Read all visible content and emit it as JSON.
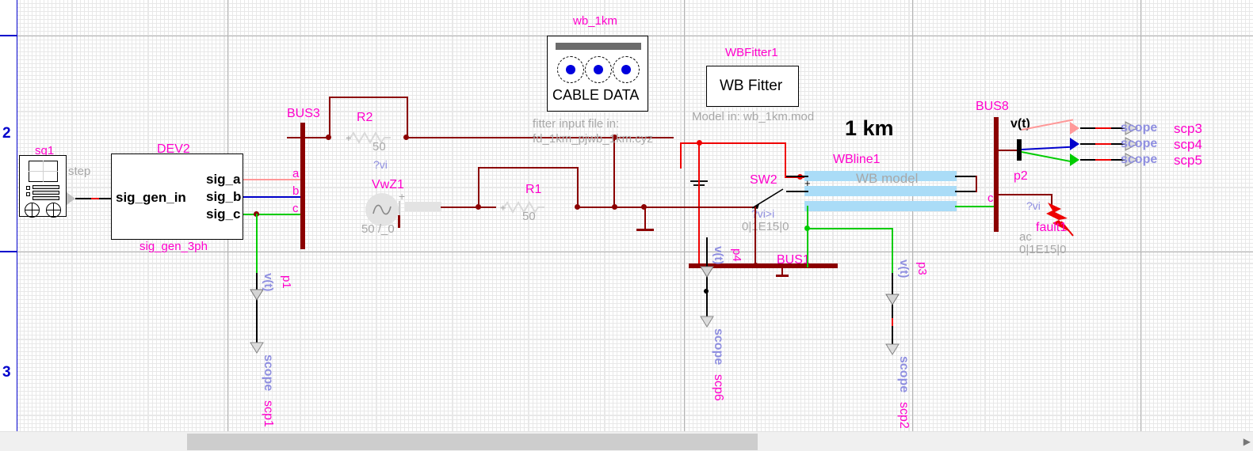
{
  "gutter": {
    "rows": [
      "2",
      "3"
    ]
  },
  "components": {
    "sg1": {
      "ref": "sg1",
      "param": "step",
      "icon": "signal-generator-icon"
    },
    "dev2": {
      "ref": "DEV2",
      "subtitle": "sig_gen_3ph",
      "in_pin": "sig_gen_in",
      "out_pins": [
        "sig_a",
        "sig_b",
        "sig_c"
      ],
      "phase_labels": [
        "a",
        "b",
        "c"
      ]
    },
    "bus3": {
      "ref": "BUS3"
    },
    "r2": {
      "ref": "R2",
      "value": "50",
      "annot": "?vi"
    },
    "r1": {
      "ref": "R1",
      "value": "50"
    },
    "vwz1": {
      "ref": "VwZ1",
      "value": "50 /_0",
      "polarity": "+"
    },
    "cable_data": {
      "ref": "wb_1km",
      "caption": "CABLE DATA",
      "note_line1": "fitter input file in:",
      "note_line2": "fd_1km_pjwb_1km.cyz"
    },
    "wbfitter": {
      "ref": "WBFitter1",
      "caption": "WB Fitter",
      "note": "Model in: wb_1km.mod"
    },
    "sw2": {
      "ref": "SW2",
      "annot": "?vi>i",
      "params": "0|1E15|0"
    },
    "bus1": {
      "ref": "BUS1"
    },
    "wbline1": {
      "ref": "WBline1",
      "caption": "WB model",
      "length": "1 km",
      "polarity": "+",
      "pin_c": "c"
    },
    "bus8": {
      "ref": "BUS8",
      "meter": "v(t)",
      "node": "p2",
      "annot": "?vi"
    },
    "fault1": {
      "ref": "fault1",
      "type": "ac",
      "params": "0|1E15|0"
    }
  },
  "probes": [
    {
      "name": "p1",
      "meter": "v(t)",
      "scope_label": "scope",
      "scope_ref": "scp1"
    },
    {
      "name": "p4",
      "meter": "v(t)",
      "scope_label": "scope",
      "scope_ref": "scp6"
    },
    {
      "name": "p3",
      "meter": "v(t)",
      "scope_label": "scope",
      "scope_ref": "scp2"
    }
  ],
  "scopes_right": [
    {
      "label": "scope",
      "ref": "scp3"
    },
    {
      "label": "scope",
      "ref": "scp4"
    },
    {
      "label": "scope",
      "ref": "scp5"
    }
  ],
  "colors": {
    "ref_pink": "#ff00cc",
    "param_grey": "#a8a8a8",
    "meter_blue": "#8f8fe0",
    "wire_darkred": "#8b0000",
    "wire_red": "#ee0000",
    "phase_a": "#ff9999",
    "phase_b": "#0000cc",
    "phase_c": "#00cc00",
    "line_blue": "#aadcf7",
    "gutter_blue": "#0000cc"
  }
}
